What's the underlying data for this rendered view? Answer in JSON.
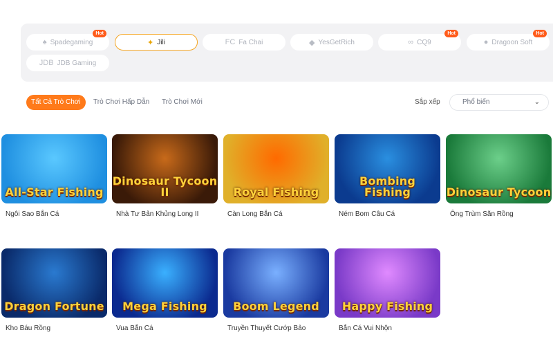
{
  "providers": [
    {
      "name": "Spadegaming",
      "icon": "spadegaming-logo-icon",
      "glyph": "♠",
      "hot": true,
      "active": false
    },
    {
      "name": "Jili",
      "icon": "jili-logo-icon",
      "glyph": "✦",
      "hot": false,
      "active": true
    },
    {
      "name": "Fa Chai",
      "icon": "fachai-logo-icon",
      "glyph": "FC",
      "hot": false,
      "active": false
    },
    {
      "name": "YesGetRich",
      "icon": "yesgetrich-logo-icon",
      "glyph": "◆",
      "hot": false,
      "active": false
    },
    {
      "name": "CQ9",
      "icon": "cq9-logo-icon",
      "glyph": "∞",
      "hot": true,
      "active": false
    },
    {
      "name": "Dragoon Soft",
      "icon": "dragoonsoft-logo-icon",
      "glyph": "●",
      "hot": true,
      "active": false
    },
    {
      "name": "JDB Gaming",
      "icon": "jdb-logo-icon",
      "glyph": "JDB",
      "hot": false,
      "active": false
    }
  ],
  "hot_label": "Hot",
  "tabs": [
    {
      "label": "Tất Cả Trò Chơi",
      "active": true
    },
    {
      "label": "Trò Chơi Hấp Dẫn",
      "active": false
    },
    {
      "label": "Trò Chơi Mới",
      "active": false
    }
  ],
  "sort": {
    "label": "Sắp xếp",
    "selected": "Phổ biến"
  },
  "games": [
    {
      "title": "Ngôi Sao Bắn Cá",
      "logo_text": "All-Star Fishing",
      "colors": [
        "#1f8fe0",
        "#5ac8ff"
      ]
    },
    {
      "title": "Nhà Tư Bản Khủng Long II",
      "logo_text": "Dinosaur Tycoon II",
      "colors": [
        "#3a1a08",
        "#c86a1a"
      ]
    },
    {
      "title": "Càn Long Bắn Cá",
      "logo_text": "Royal Fishing",
      "colors": [
        "#e0b02a",
        "#ff6a00"
      ]
    },
    {
      "title": "Ném Bom Câu Cá",
      "logo_text": "Bombing Fishing",
      "colors": [
        "#0b3b8f",
        "#2a8fe0"
      ]
    },
    {
      "title": "Ông Trùm Săn Rồng",
      "logo_text": "Dinosaur Tycoon",
      "colors": [
        "#1a7a3a",
        "#6ccf8a"
      ]
    },
    {
      "title": "Kho Báu Rồng",
      "logo_text": "Dragon Fortune",
      "colors": [
        "#0a2a6a",
        "#2a7ad0"
      ]
    },
    {
      "title": "Vua Bắn Cá",
      "logo_text": "Mega Fishing",
      "colors": [
        "#0b2a8f",
        "#3ab0ff"
      ]
    },
    {
      "title": "Truyền Thuyết Cướp Bảo",
      "logo_text": "Boom Legend",
      "colors": [
        "#1a3aa0",
        "#7ab0ff"
      ]
    },
    {
      "title": "Bắn Cá Vui Nhộn",
      "logo_text": "Happy Fishing",
      "colors": [
        "#7a3ac8",
        "#e08aff"
      ]
    }
  ]
}
